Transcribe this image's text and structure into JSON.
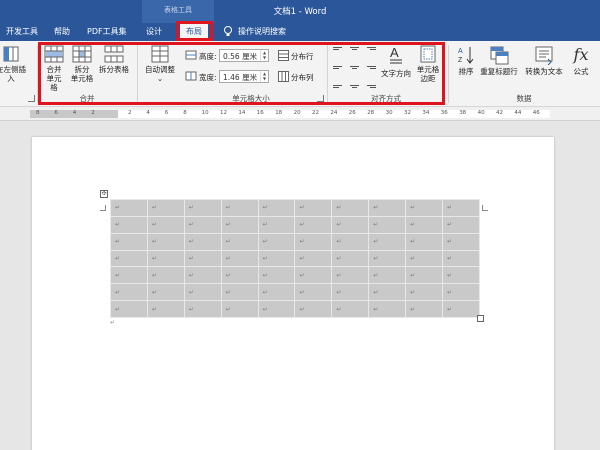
{
  "titlebar": {
    "context_group": "表格工具",
    "doc_title": "文档1 - Word"
  },
  "tabs": {
    "items": [
      "开发工具",
      "帮助",
      "PDF工具集",
      "设计",
      "布局"
    ],
    "active": "布局",
    "tell_me": "操作说明搜索"
  },
  "ribbon": {
    "insert_left": "在左侧插入",
    "merge_group": {
      "label": "合并",
      "merge_cells": [
        "合并",
        "单元格"
      ],
      "split_cells": [
        "拆分",
        "单元格"
      ],
      "split_table": "拆分表格"
    },
    "cell_size_group": {
      "label": "单元格大小",
      "autofit": "自动调整",
      "height_label": "高度:",
      "height_value": "0.56 厘米",
      "width_label": "宽度:",
      "width_value": "1.46 厘米",
      "distribute_rows": "分布行",
      "distribute_cols": "分布列"
    },
    "alignment_group": {
      "label": "对齐方式",
      "text_direction": "文字方向",
      "cell_margins": [
        "单元格",
        "边距"
      ]
    },
    "data_group": {
      "label": "数据",
      "sort": "排序",
      "repeat_header": "重复标题行",
      "convert_text": "转换为文本",
      "formula": "公式"
    }
  },
  "ruler": {
    "numbers": [
      "8",
      "6",
      "4",
      "2",
      "",
      "2",
      "4",
      "6",
      "8",
      "10",
      "12",
      "14",
      "16",
      "18",
      "20",
      "22",
      "24",
      "26",
      "28",
      "30",
      "32",
      "34",
      "36",
      "38",
      "40",
      "42",
      "44",
      "46"
    ]
  },
  "document": {
    "table": {
      "rows": 7,
      "cols": 10,
      "cell_mark": "↵"
    },
    "para_mark": "↵"
  },
  "colors": {
    "title_blue": "#2b579a",
    "highlight_red": "#e0141e",
    "table_cell_gray": "#c9c9c9"
  }
}
